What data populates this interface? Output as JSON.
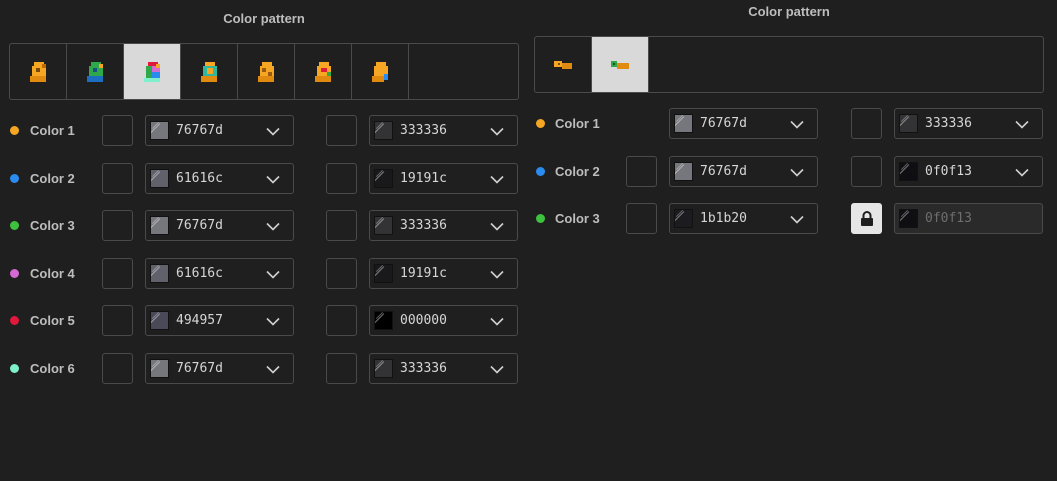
{
  "left_panel": {
    "title": "Color pattern",
    "patterns": [
      {
        "icon": "orange-creature-icon",
        "selected": false
      },
      {
        "icon": "green-blue-creature-icon",
        "selected": false
      },
      {
        "icon": "rainbow-creature-icon",
        "selected": true
      },
      {
        "icon": "teal-orange-creature-icon",
        "selected": false
      },
      {
        "icon": "spotted-orange-creature-icon",
        "selected": false
      },
      {
        "icon": "red-orange-creature-icon",
        "selected": false
      },
      {
        "icon": "orange-blue-creature-icon",
        "selected": false
      }
    ],
    "rows": [
      {
        "label": "Color 1",
        "dot": "#f5a623",
        "primary": {
          "hex": "76767d",
          "swatch": "#76767d"
        },
        "secondary": {
          "hex": "333336",
          "swatch": "#333336"
        }
      },
      {
        "label": "Color 2",
        "dot": "#2b8cf0",
        "primary": {
          "hex": "61616c",
          "swatch": "#61616c"
        },
        "secondary": {
          "hex": "19191c",
          "swatch": "#19191c"
        }
      },
      {
        "label": "Color 3",
        "dot": "#3ec13e",
        "primary": {
          "hex": "76767d",
          "swatch": "#76767d"
        },
        "secondary": {
          "hex": "333336",
          "swatch": "#333336"
        }
      },
      {
        "label": "Color 4",
        "dot": "#d46ad4",
        "primary": {
          "hex": "61616c",
          "swatch": "#61616c"
        },
        "secondary": {
          "hex": "19191c",
          "swatch": "#19191c"
        }
      },
      {
        "label": "Color 5",
        "dot": "#e0183c",
        "primary": {
          "hex": "494957",
          "swatch": "#494957"
        },
        "secondary": {
          "hex": "000000",
          "swatch": "#000000"
        }
      },
      {
        "label": "Color 6",
        "dot": "#7ef0cc",
        "primary": {
          "hex": "76767d",
          "swatch": "#76767d"
        },
        "secondary": {
          "hex": "333336",
          "swatch": "#333336"
        }
      }
    ]
  },
  "right_panel": {
    "title": "Color pattern",
    "patterns": [
      {
        "icon": "orange-fish-icon",
        "selected": false
      },
      {
        "icon": "green-orange-fish-icon",
        "selected": true
      }
    ],
    "rows": [
      {
        "label": "Color 1",
        "dot": "#f5a623",
        "primary": {
          "hex": "76767d",
          "swatch": "#76767d"
        },
        "secondary": {
          "hex": "333336",
          "swatch": "#333336"
        }
      },
      {
        "label": "Color 2",
        "dot": "#2b8cf0",
        "primary": {
          "hex": "76767d",
          "swatch": "#76767d"
        },
        "secondary": {
          "hex": "0f0f13",
          "swatch": "#0f0f13"
        }
      },
      {
        "label": "Color 3",
        "dot": "#3ec13e",
        "primary": {
          "hex": "1b1b20",
          "swatch": "#1b1b20"
        },
        "secondary": {
          "hex": "0f0f13",
          "swatch": "#0f0f13",
          "locked": true
        }
      }
    ]
  }
}
